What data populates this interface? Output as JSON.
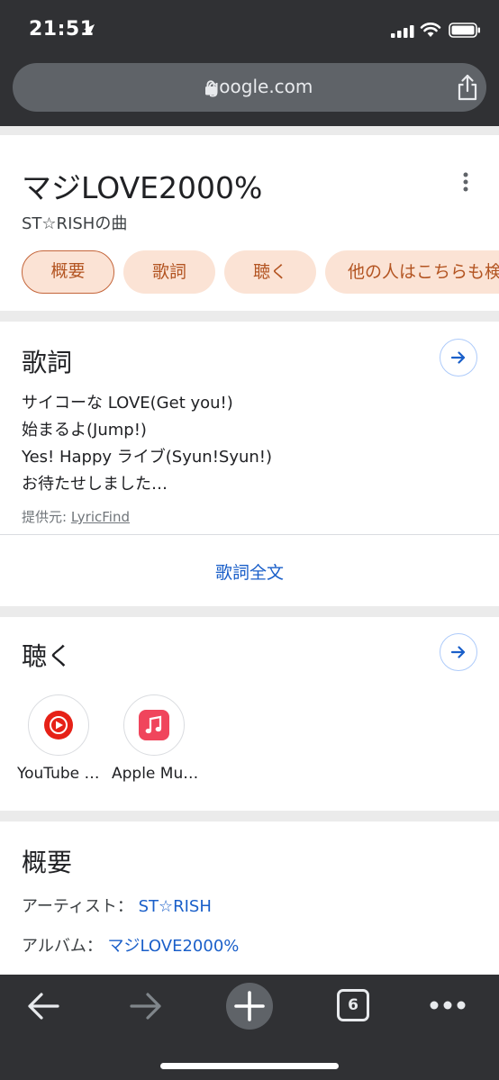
{
  "status_bar": {
    "time": "21:51"
  },
  "browser": {
    "url": "google.com"
  },
  "header_card": {
    "title": "マジLOVE2000%",
    "subtitle": "ST☆RISHの曲",
    "chips": [
      "概要",
      "歌詞",
      "聴く",
      "他の人はこちらも検索"
    ]
  },
  "lyrics_card": {
    "title": "歌詞",
    "lines": [
      "サイコーな LOVE(Get you!)",
      "始まるよ(Jump!)",
      "Yes! Happy ライブ(Syun!Syun!)",
      "お待たせしました…"
    ],
    "source_label": "提供元: ",
    "source_name": "LyricFind",
    "full_lyrics": "歌詞全文"
  },
  "listen_card": {
    "title": "聴く",
    "apps": [
      {
        "label": "YouTube …",
        "icon": "youtube-music-icon",
        "color": "#e62117"
      },
      {
        "label": "Apple Mu…",
        "icon": "apple-music-icon",
        "color": "#f0455c"
      }
    ]
  },
  "overview_card": {
    "title": "概要",
    "rows": [
      {
        "key": "アーティスト： ",
        "value": "ST☆RISH"
      },
      {
        "key": "アルバム： ",
        "value": "マジLOVE2000%"
      }
    ]
  },
  "toolbar": {
    "tab_count": "6"
  },
  "colors": {
    "chrome": "#303134",
    "link": "#1a5fc9",
    "chip_bg": "#fbe3d5",
    "chip_text": "#b35421"
  }
}
